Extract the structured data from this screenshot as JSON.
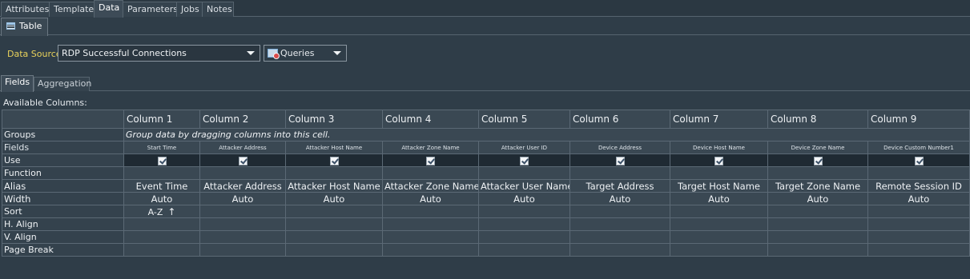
{
  "top_tabs": [
    {
      "label": "Attributes",
      "active": false
    },
    {
      "label": "Template",
      "active": false
    },
    {
      "label": "Data",
      "active": true
    },
    {
      "label": "Parameters",
      "active": false
    },
    {
      "label": "Jobs",
      "active": false
    },
    {
      "label": "Notes",
      "active": false
    }
  ],
  "sub_tab": {
    "label": "Table",
    "icon": "table-icon"
  },
  "data_source": {
    "label": "Data Source:",
    "value": "RDP Successful Connections",
    "queries_label": "Queries",
    "queries_icon": "queries-icon"
  },
  "field_tabs": [
    {
      "label": "Fields",
      "active": true
    },
    {
      "label": "Aggregation",
      "active": false
    }
  ],
  "available_columns_label": "Available Columns:",
  "grid": {
    "columns": [
      "Column 1",
      "Column 2",
      "Column 3",
      "Column 4",
      "Column 5",
      "Column 6",
      "Column 7",
      "Column 8",
      "Column 9"
    ],
    "row_labels": {
      "groups": "Groups",
      "fields": "Fields",
      "use": "Use",
      "function": "Function",
      "alias": "Alias",
      "width": "Width",
      "sort": "Sort",
      "h_align": "H. Align",
      "v_align": "V. Align",
      "page_break": "Page Break"
    },
    "groups_hint": "Group data by dragging columns into this cell.",
    "fields": [
      "Start Time",
      "Attacker Address",
      "Attacker Host Name",
      "Attacker Zone Name",
      "Attacker User ID",
      "Device Address",
      "Device Host Name",
      "Device Zone Name",
      "Device Custom Number1"
    ],
    "use": [
      true,
      true,
      true,
      true,
      true,
      true,
      true,
      true,
      true
    ],
    "alias": [
      "Event Time",
      "Attacker Address",
      "Attacker Host Name",
      "Attacker Zone Name",
      "Attacker User Name",
      "Target Address",
      "Target Host Name",
      "Target Zone Name",
      "Remote Session ID"
    ],
    "width": [
      "Auto",
      "Auto",
      "Auto",
      "Auto",
      "Auto",
      "Auto",
      "Auto",
      "Auto",
      "Auto"
    ],
    "sort_col1": "A-Z",
    "sort_arrow": "↑"
  }
}
